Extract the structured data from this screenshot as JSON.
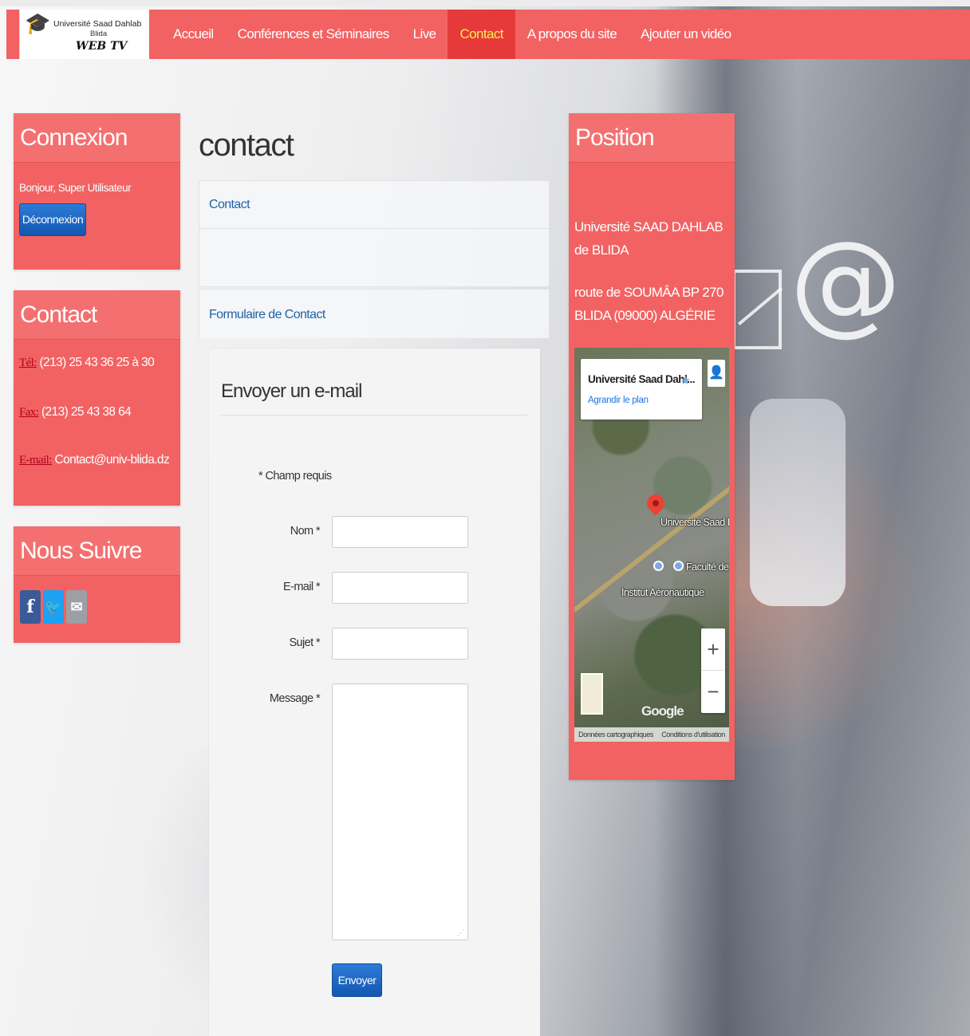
{
  "nav": {
    "logo": {
      "line1": "Université Saad Dahlab",
      "line2": "Blida",
      "line3": "WEB TV"
    },
    "items": [
      {
        "label": "Accueil",
        "active": false
      },
      {
        "label": "Conférences et Séminaires",
        "active": false
      },
      {
        "label": "Live",
        "active": false
      },
      {
        "label": "Contact",
        "active": true
      },
      {
        "label": "A propos du site",
        "active": false
      },
      {
        "label": "Ajouter un vidéo",
        "active": false
      }
    ]
  },
  "sidebar_left": {
    "connexion": {
      "title": "Connexion",
      "greeting": "Bonjour, Super Utilisateur",
      "logout_label": "Déconnexion"
    },
    "contact": {
      "title": "Contact",
      "tel_label": "Tél:",
      "tel_value": "(213) 25 43 36 25 à 30",
      "fax_label": "Fax:",
      "fax_value": "(213) 25 43 38 64",
      "email_label": "E-mail:",
      "email_value": "Contact@univ-blida.dz"
    },
    "follow": {
      "title": "Nous Suivre",
      "icons": [
        "facebook-icon",
        "twitter-icon",
        "mail-icon"
      ]
    }
  },
  "main": {
    "page_title": "contact",
    "contact_card_title": "Contact",
    "form_card_title": "Formulaire de Contact",
    "form": {
      "legend": "Envoyer un e-mail",
      "required_note": "* Champ requis",
      "fields": {
        "name_label": "Nom *",
        "email_label": "E-mail *",
        "subject_label": "Sujet *",
        "message_label": "Message *"
      },
      "submit_label": "Envoyer"
    }
  },
  "sidebar_right": {
    "title": "Position",
    "address_line1": "Université SAAD DAHLAB de BLIDA",
    "address_line2": "route de SOUMÂA BP 270 BLIDA (09000) ALGÉRIE",
    "map": {
      "place_name": "Université Saad Dahl...",
      "enlarge_label": "Agrandir le plan",
      "label_university": "Université Saad Dal",
      "label_faculty": "Faculté de r",
      "label_institute": "Institut Aéronautique",
      "zoom_in": "+",
      "zoom_out": "−",
      "brand": "Google",
      "footer_data": "Données cartographiques",
      "footer_terms": "Conditions d'utilisation"
    }
  },
  "colors": {
    "accent": "#f26262",
    "nav_active_bg": "#e63a3a",
    "nav_active_text": "#ffeb55",
    "link": "#1e63a8",
    "button": "#1357b1"
  }
}
